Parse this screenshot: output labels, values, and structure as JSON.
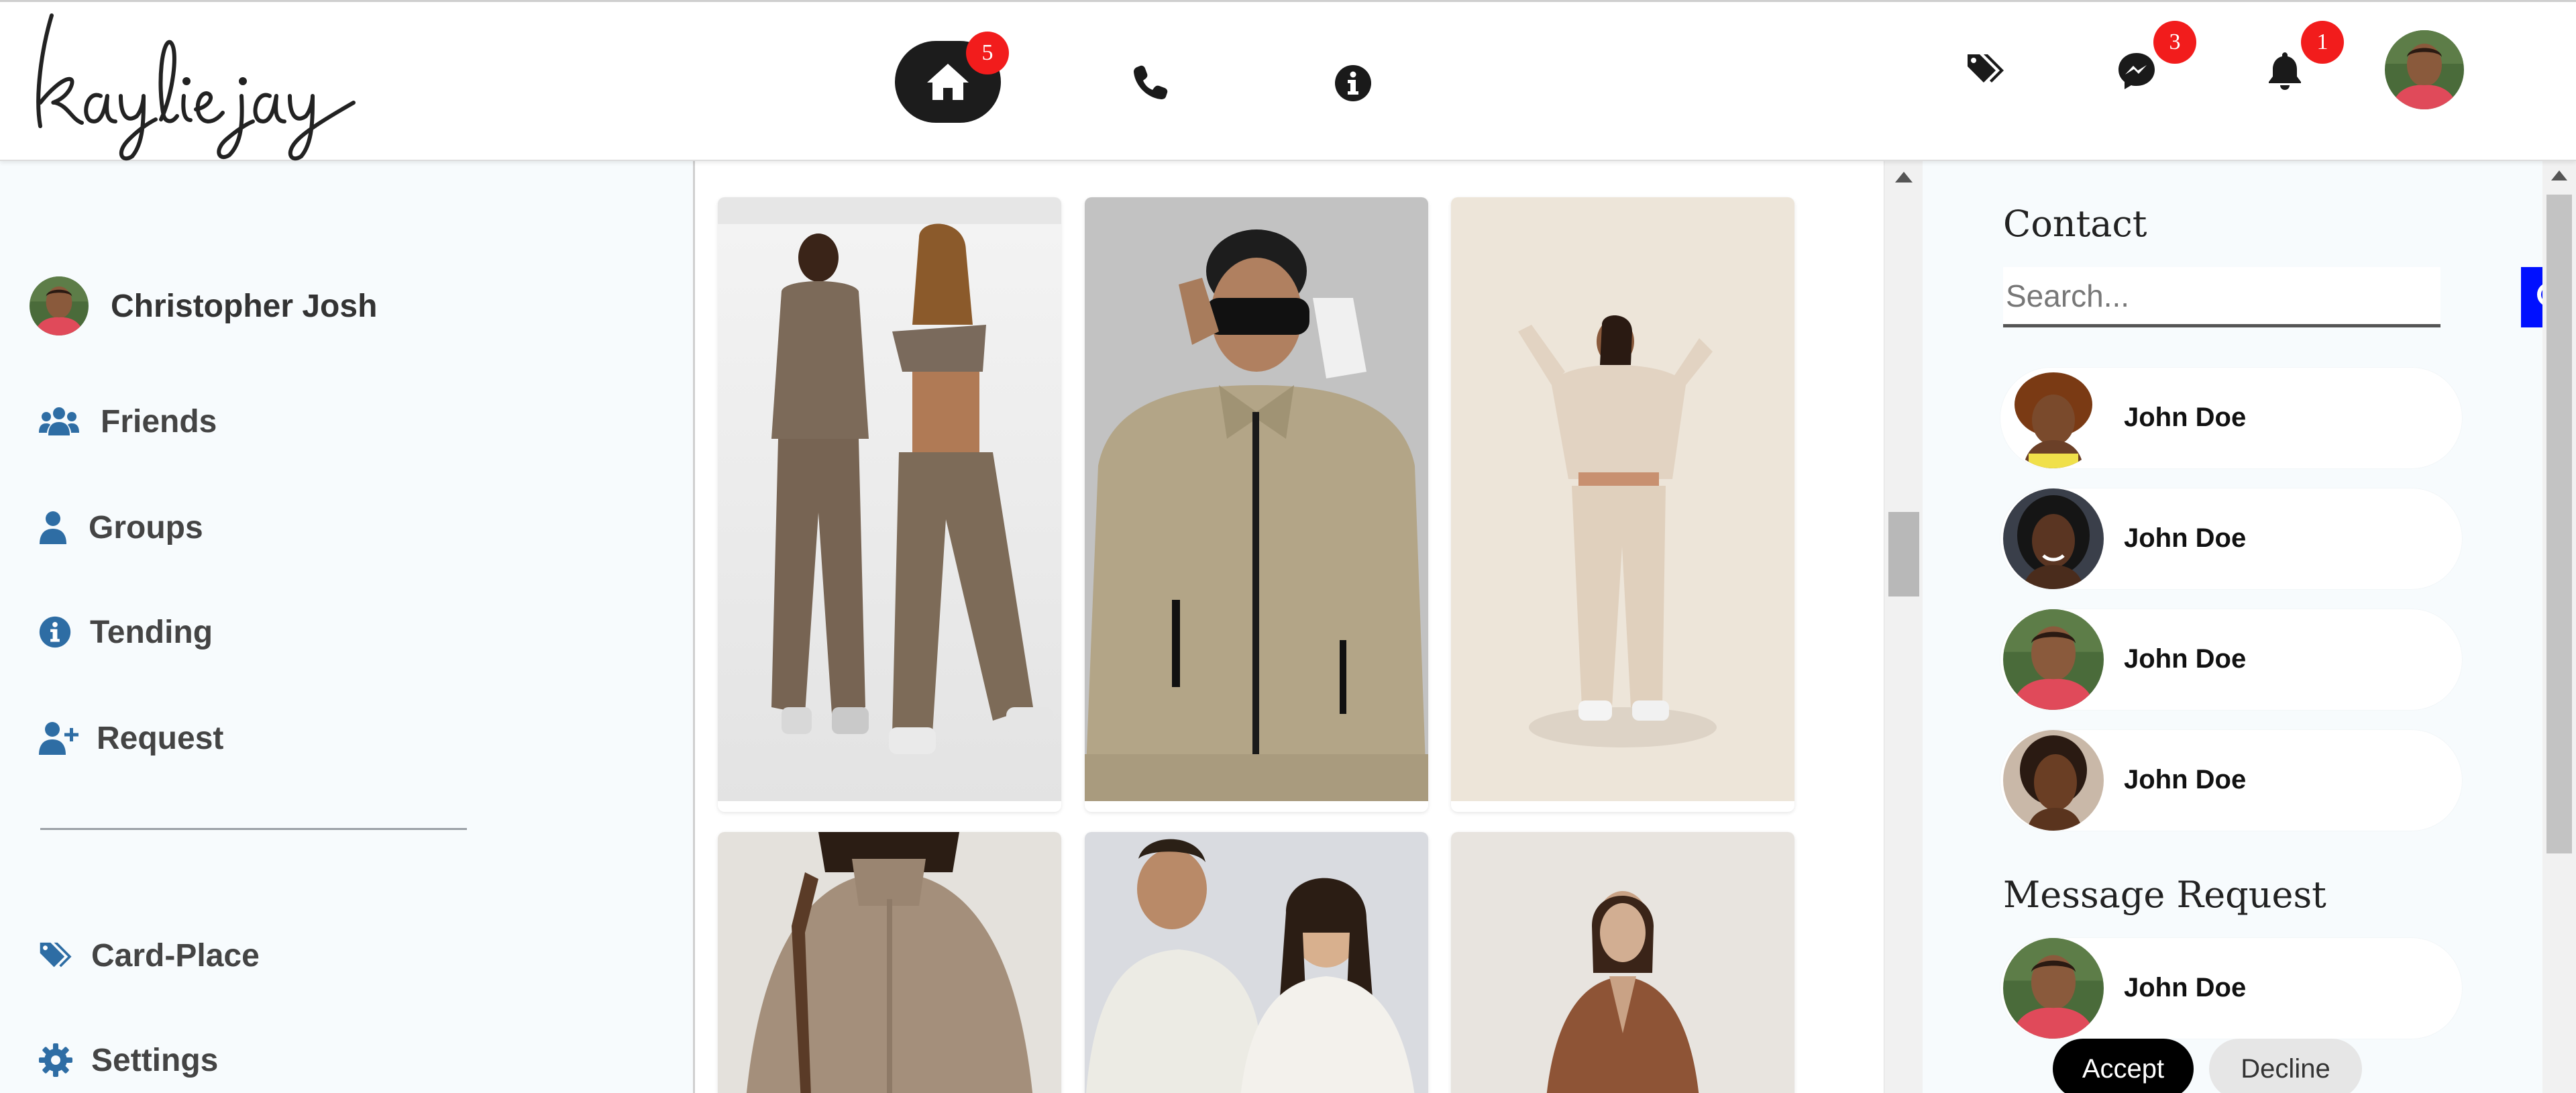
{
  "brand": {
    "logo_text": "kaylie jay"
  },
  "header": {
    "nav": [
      {
        "name": "home",
        "icon": "home-icon",
        "badge": "5",
        "active": true
      },
      {
        "name": "phone",
        "icon": "phone-icon"
      },
      {
        "name": "info",
        "icon": "info-icon"
      }
    ],
    "actions": [
      {
        "name": "tags",
        "icon": "tags-icon"
      },
      {
        "name": "messenger",
        "icon": "messenger-icon",
        "badge": "3"
      },
      {
        "name": "notifications",
        "icon": "bell-icon",
        "badge": "1"
      }
    ]
  },
  "sidebar": {
    "profile_name": "Christopher Josh",
    "menu": [
      {
        "label": "Friends",
        "icon": "users-icon"
      },
      {
        "label": "Groups",
        "icon": "user-icon"
      },
      {
        "label": "Tending",
        "icon": "info-icon"
      },
      {
        "label": "Request",
        "icon": "user-plus-icon"
      }
    ],
    "menu_bottom": [
      {
        "label": "Card-Place",
        "icon": "tags-icon"
      },
      {
        "label": "Settings",
        "icon": "gear-icon"
      }
    ]
  },
  "feed": {
    "posts": [
      {
        "alt": "couple-tracksuit"
      },
      {
        "alt": "man-jacket-goggles"
      },
      {
        "alt": "woman-beige-set"
      },
      {
        "alt": "woman-knit-jacket"
      },
      {
        "alt": "couple-white-sweaters"
      },
      {
        "alt": "woman-brown-coat"
      }
    ]
  },
  "right": {
    "contact_title": "Contact",
    "search_placeholder": "Search...",
    "contacts": [
      {
        "name": "John Doe"
      },
      {
        "name": "John Doe"
      },
      {
        "name": "John Doe"
      },
      {
        "name": "John Doe"
      }
    ],
    "request_title": "Message Request",
    "request": {
      "name": "John Doe",
      "accept": "Accept",
      "decline": "Decline"
    }
  },
  "colors": {
    "accent_blue": "#0010ff",
    "badge_red": "#f21c1c",
    "icon_blue": "#2e6da4",
    "panel_bg": "#f7fbfd"
  }
}
